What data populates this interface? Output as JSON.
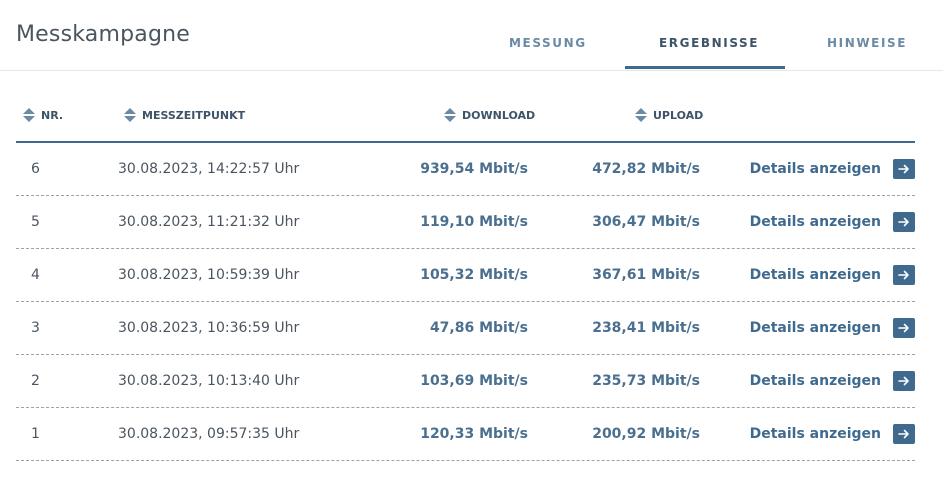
{
  "header": {
    "title": "Messkampagne",
    "tabs": [
      {
        "label": "MESSUNG",
        "active": false
      },
      {
        "label": "ERGEBNISSE",
        "active": true
      },
      {
        "label": "HINWEISE",
        "active": false
      }
    ]
  },
  "table": {
    "columns": [
      {
        "label": "NR.",
        "icon": "sort-icon"
      },
      {
        "label": "MESSZEITPUNKT",
        "icon": "sort-icon"
      },
      {
        "label": "DOWNLOAD",
        "icon": "sort-icon"
      },
      {
        "label": "UPLOAD",
        "icon": "sort-icon"
      }
    ],
    "action_label": "Details anzeigen",
    "action_icon": "arrow-right-icon",
    "rows": [
      {
        "nr": "6",
        "timestamp": "30.08.2023, 14:22:57 Uhr",
        "download": "939,54 Mbit/s",
        "upload": "472,82 Mbit/s"
      },
      {
        "nr": "5",
        "timestamp": "30.08.2023, 11:21:32 Uhr",
        "download": "119,10 Mbit/s",
        "upload": "306,47 Mbit/s"
      },
      {
        "nr": "4",
        "timestamp": "30.08.2023, 10:59:39 Uhr",
        "download": "105,32 Mbit/s",
        "upload": "367,61 Mbit/s"
      },
      {
        "nr": "3",
        "timestamp": "30.08.2023, 10:36:59 Uhr",
        "download": "47,86 Mbit/s",
        "upload": "238,41 Mbit/s"
      },
      {
        "nr": "2",
        "timestamp": "30.08.2023, 10:13:40 Uhr",
        "download": "103,69 Mbit/s",
        "upload": "235,73 Mbit/s"
      },
      {
        "nr": "1",
        "timestamp": "30.08.2023, 09:57:35 Uhr",
        "download": "120,33 Mbit/s",
        "upload": "200,92 Mbit/s"
      }
    ]
  },
  "colors": {
    "accent": "#3f6a8e",
    "value_text": "#4a6f8f",
    "tab_inactive": "#6b8aa5"
  }
}
